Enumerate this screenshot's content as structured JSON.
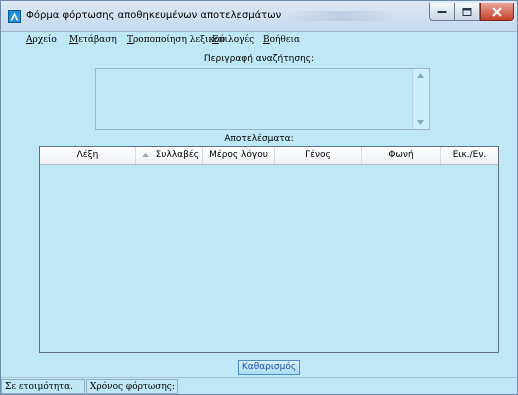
{
  "window": {
    "title": "Φόρμα φόρτωσης αποθηκευμένων αποτελεσμάτων"
  },
  "menu": [
    {
      "first": "Α",
      "rest": "ρχείο"
    },
    {
      "first": "Μ",
      "rest": "ετάβαση"
    },
    {
      "first": "Τ",
      "rest": "ροποποίηση λεξικού"
    },
    {
      "first": "Ε",
      "rest": "πιλογές"
    },
    {
      "first": "Β",
      "rest": "οήθεια"
    }
  ],
  "search": {
    "description_label": "Περιγραφή αναζήτησης:",
    "description_value": ""
  },
  "results": {
    "label": "Αποτελέσματα:",
    "columns": [
      "Λέξη",
      "Συλλαβές",
      "Μέρος λόγου",
      "Γένος",
      "Φωνή",
      "Εικ./Εν."
    ],
    "sorted_column": "Συλλαβές",
    "rows": []
  },
  "buttons": {
    "clear": "Καθαρισμός"
  },
  "status": {
    "ready": "Σε ετοιμότητα.",
    "load_time": "Χρόνος φόρτωσης:"
  },
  "colors": {
    "window_bg": "#bfe8f7",
    "titlebar": "#c5d9ee",
    "close_button": "#c7402b",
    "clear_button_text": "#1f4fa8"
  }
}
